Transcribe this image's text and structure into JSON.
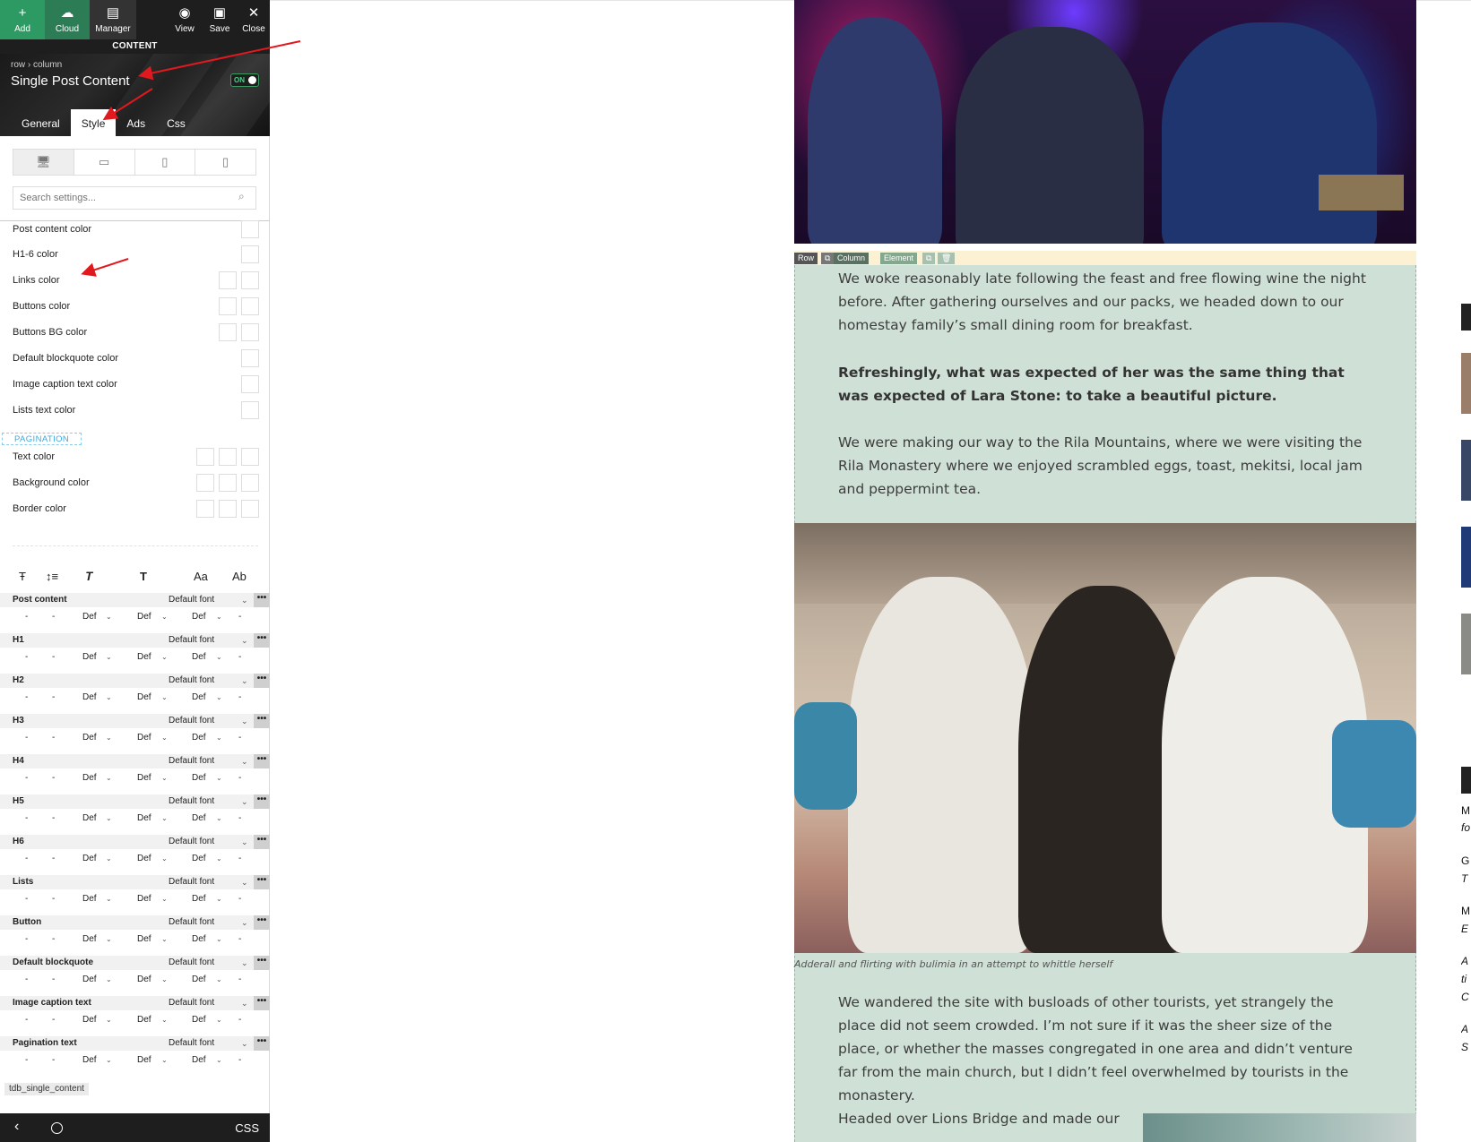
{
  "toolbar": {
    "add_label": "Add",
    "cloud_label": "Cloud",
    "manager_label": "Manager",
    "view_label": "View",
    "save_label": "Save",
    "close_label": "Close"
  },
  "panel": {
    "section_label": "CONTENT",
    "breadcrumb": "row › column",
    "element_title": "Single Post Content",
    "toggle_label": "ON",
    "tabs": [
      "General",
      "Style",
      "Ads",
      "Css"
    ],
    "active_tab": "Style",
    "search_placeholder": "Search settings...",
    "color_settings": [
      {
        "label": "Post content color",
        "swatches": 1
      },
      {
        "label": "H1-6 color",
        "swatches": 1
      },
      {
        "label": "Links color",
        "swatches": 2
      },
      {
        "label": "Buttons color",
        "swatches": 2
      },
      {
        "label": "Buttons BG color",
        "swatches": 2
      },
      {
        "label": "Default blockquote color",
        "swatches": 1
      },
      {
        "label": "Image caption text color",
        "swatches": 1
      },
      {
        "label": "Lists text color",
        "swatches": 1
      }
    ],
    "pagination_label": "PAGINATION",
    "pagination_settings": [
      {
        "label": "Text color",
        "swatches": 3
      },
      {
        "label": "Background color",
        "swatches": 3
      },
      {
        "label": "Border color",
        "swatches": 3
      }
    ],
    "typography_icons": [
      "Ŧ",
      "↕≡",
      "𝑻",
      "T",
      "Aa",
      "Ab"
    ],
    "typography_rows": [
      {
        "label": "Post content",
        "font": "Default font"
      },
      {
        "label": "H1",
        "font": "Default font"
      },
      {
        "label": "H2",
        "font": "Default font"
      },
      {
        "label": "H3",
        "font": "Default font"
      },
      {
        "label": "H4",
        "font": "Default font"
      },
      {
        "label": "H5",
        "font": "Default font"
      },
      {
        "label": "H6",
        "font": "Default font"
      },
      {
        "label": "Lists",
        "font": "Default font"
      },
      {
        "label": "Button",
        "font": "Default font"
      },
      {
        "label": "Default blockquote",
        "font": "Default font"
      },
      {
        "label": "Image caption text",
        "font": "Default font"
      },
      {
        "label": "Pagination text",
        "font": "Default font"
      }
    ],
    "sub_values": {
      "dash": "-",
      "def": "Def",
      "more": "•••"
    },
    "class_name": "tdb_single_content",
    "bottom_css_label": "CSS"
  },
  "preview": {
    "outline_labels": [
      "Row",
      "Column",
      "Element"
    ],
    "paragraphs": [
      "We woke reasonably late following the feast and free flowing wine the night before. After gathering ourselves and our packs, we headed down to our homestay family’s small dining room for breakfast.",
      "Refreshingly, what was expected of her was the same thing that was expected of Lara Stone: to take a beautiful picture.",
      "We were making our way to the Rila Mountains, where we were visiting the Rila Monastery where we enjoyed scrambled eggs, toast, mekitsi, local jam and peppermint tea."
    ],
    "caption": "Adderall and flirting with bulimia in an attempt to whittle herself",
    "paragraphs_after": [
      "We wandered the site with busloads of other tourists, yet strangely the place did not seem crowded. I’m not sure if it was the sheer size of the place, or whether the masses congregated in one area and didn’t venture far from the main church, but I didn’t feel overwhelmed by tourists in the monastery.",
      "Headed over Lions Bridge and made our"
    ],
    "sidebar_letters": [
      "M",
      "fo",
      "G",
      "T",
      "M",
      "E",
      "A",
      "ti",
      "C",
      "A",
      "S"
    ]
  },
  "colors": {
    "add_green": "#2d9a63",
    "panel_dark": "#1e1e1e",
    "content_bg": "#cfe0d6",
    "pagination_blue": "#3da9dd",
    "arrow_red": "#e0191f"
  }
}
